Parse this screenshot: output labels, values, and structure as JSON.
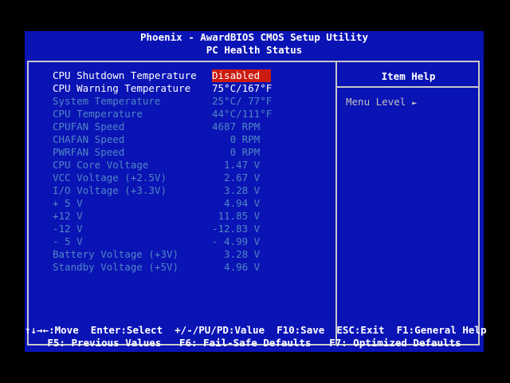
{
  "header": {
    "title": "Phoenix - AwardBIOS CMOS Setup Utility",
    "subtitle": "PC Health Status"
  },
  "settings": [
    {
      "label": "CPU Shutdown Temperature",
      "value": "Disabled",
      "state": "selected"
    },
    {
      "label": "CPU Warning Temperature",
      "value": "75°C/167°F",
      "state": "active"
    },
    {
      "label": "System Temperature",
      "value": "25°C/ 77°F",
      "state": "dim"
    },
    {
      "label": "CPU Temperature",
      "value": "44°C/111°F",
      "state": "dim"
    },
    {
      "label": "CPUFAN Speed",
      "value": "4687 RPM",
      "state": "dim"
    },
    {
      "label": "CHAFAN Speed",
      "value": "   0 RPM",
      "state": "dim"
    },
    {
      "label": "PWRFAN Speed",
      "value": "   0 RPM",
      "state": "dim"
    },
    {
      "label": "CPU Core Voltage",
      "value": "  1.47 V",
      "state": "dim"
    },
    {
      "label": "VCC Voltage (+2.5V)",
      "value": "  2.67 V",
      "state": "dim"
    },
    {
      "label": "I/O Voltage (+3.3V)",
      "value": "  3.28 V",
      "state": "dim"
    },
    {
      "label": "+ 5 V",
      "value": "  4.94 V",
      "state": "dim"
    },
    {
      "label": "+12 V",
      "value": " 11.85 V",
      "state": "dim"
    },
    {
      "label": "-12 V",
      "value": "-12.83 V",
      "state": "dim"
    },
    {
      "label": "- 5 V",
      "value": "- 4.99 V",
      "state": "dim"
    },
    {
      "label": "Battery Voltage (+3V)",
      "value": "  3.28 V",
      "state": "dim"
    },
    {
      "label": "Standby Voltage (+5V)",
      "value": "  4.96 V",
      "state": "dim"
    }
  ],
  "help": {
    "title": "Item Help",
    "menu_level_label": "Menu Level",
    "menu_level_arrow": "►"
  },
  "footer": {
    "line1": "↑↓→←:Move  Enter:Select  +/-/PU/PD:Value  F10:Save  ESC:Exit  F1:General Help",
    "line2": "F5: Previous Values   F6: Fail-Safe Defaults   F7: Optimized Defaults"
  },
  "colors": {
    "background": "#0a13b4",
    "highlight": "#cc1b10",
    "active_text": "#ffffff",
    "dim_text": "#4f86c4",
    "frame": "#c8c8c8"
  }
}
